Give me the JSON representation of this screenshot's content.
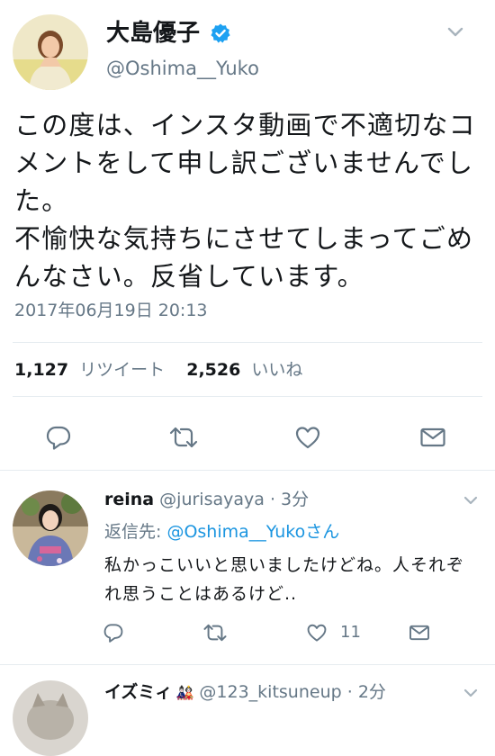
{
  "tweet": {
    "display_name": "大島優子",
    "handle": "@Oshima__Yuko",
    "text": "この度は、インスタ動画で不適切なコメントをして申し訳ございませんでした。\n不愉快な気持ちにさせてしまってごめんなさい。反省しています。",
    "timestamp": "2017年06月19日 20:13",
    "retweets_count": "1,127",
    "retweets_label": "リツイート",
    "likes_count": "2,526",
    "likes_label": "いいね"
  },
  "replies": [
    {
      "display_name": "reina",
      "handle": "@jurisayaya",
      "time": "· 3分",
      "reply_to_prefix": "返信先: ",
      "reply_to_handle": "@Oshima__Yuko",
      "reply_to_suffix": "さん",
      "text": "私かっこいいと思いましたけどね。人それぞれ思うことはあるけど..",
      "likes": "11"
    },
    {
      "display_name": "イズミィ",
      "name_emoji": "🎎",
      "handle": "@123_kitsuneup",
      "time": "· 2分"
    }
  ],
  "colors": {
    "verified": "#1da1f2",
    "link": "#1b95e0",
    "muted": "#657786",
    "divider": "#e6ecf0"
  },
  "icons": [
    "verified-badge-icon",
    "chevron-down-icon",
    "reply-icon",
    "retweet-icon",
    "like-icon",
    "message-icon"
  ]
}
